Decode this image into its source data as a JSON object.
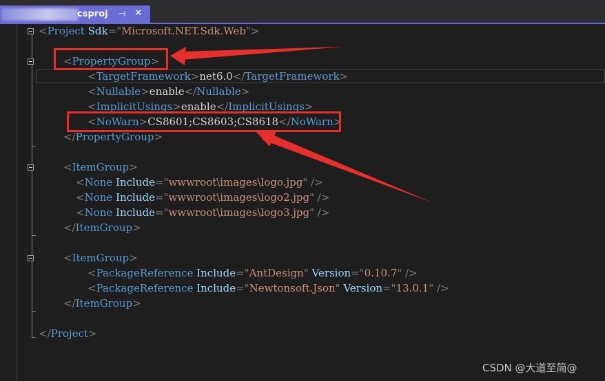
{
  "tab": {
    "title": "csproj",
    "pin_glyph": "⊣",
    "close_glyph": "✕"
  },
  "code_lines": [
    [
      "<",
      "Project",
      " ",
      "Sdk",
      "=\"",
      "Microsoft.NET.Sdk.Web",
      "\">"
    ],
    [
      "<",
      "PropertyGroup",
      ">"
    ],
    [
      "<",
      "TargetFramework",
      ">",
      "net6.0",
      "</",
      "TargetFramework",
      ">"
    ],
    [
      "<",
      "Nullable",
      ">",
      "enable",
      "</",
      "Nullable",
      ">"
    ],
    [
      "<",
      "ImplicitUsings",
      ">",
      "enable",
      "</",
      "ImplicitUsings",
      ">"
    ],
    [
      "<",
      "NoWarn",
      ">",
      "CS8601;CS8603;CS8618",
      "</",
      "NoWarn",
      ">"
    ],
    [
      "</",
      "PropertyGroup",
      ">"
    ],
    [
      "<",
      "ItemGroup",
      ">"
    ],
    [
      "<",
      "None",
      " ",
      "Include",
      "=\"",
      "wwwroot\\images\\logo.jpg",
      "\" />"
    ],
    [
      "<",
      "None",
      " ",
      "Include",
      "=\"",
      "wwwroot\\images\\logo2.jpg",
      "\" />"
    ],
    [
      "<",
      "None",
      " ",
      "Include",
      "=\"",
      "wwwroot\\images\\logo3.jpg",
      "\" />"
    ],
    [
      "</",
      "ItemGroup",
      ">"
    ],
    [
      "<",
      "ItemGroup",
      ">"
    ],
    [
      "<",
      "PackageReference",
      " ",
      "Include",
      "=\"",
      "AntDesign",
      "\" ",
      "Version",
      "=\"",
      "0.10.7",
      "\" />"
    ],
    [
      "<",
      "PackageReference",
      " ",
      "Include",
      "=\"",
      "Newtonsoft.Json",
      "\" ",
      "Version",
      "=\"",
      "13.0.1",
      "\" />"
    ],
    [
      "</",
      "ItemGroup",
      ">"
    ],
    [
      "</",
      "Project",
      ">"
    ]
  ],
  "watermark": "CSDN @大道至简@",
  "colors": {
    "editor_bg": "#1e1e1e",
    "tab_active": "#686cd4",
    "tag": "#569cd6",
    "attribute": "#9cdcfe",
    "attr_value": "#ce9178",
    "punctuation": "#808080",
    "text": "#d4d4d4",
    "annotation_red": "#e8302a"
  },
  "icons": [
    "pin-icon",
    "close-icon",
    "fold-icon",
    "arrow-annotation"
  ]
}
